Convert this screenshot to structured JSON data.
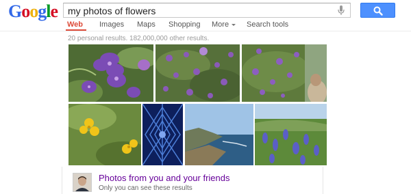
{
  "logo": {
    "text": "Google"
  },
  "search": {
    "query": "my photos of flowers",
    "button_icon": "search-icon"
  },
  "nav": {
    "tabs": [
      {
        "label": "Web",
        "active": true
      },
      {
        "label": "Images"
      },
      {
        "label": "Maps"
      },
      {
        "label": "Shopping"
      },
      {
        "label": "More"
      },
      {
        "label": "Search tools"
      }
    ]
  },
  "results": {
    "stats": "20 personal results. 182,000,000 other results."
  },
  "photos": [
    {
      "subject": "purple flowers close-up"
    },
    {
      "subject": "purple flower bush"
    },
    {
      "subject": "purple flower bush with person"
    },
    {
      "subject": "yellow flowers in grass"
    },
    {
      "subject": "blue geometric pattern"
    },
    {
      "subject": "coastal cliffs and ocean"
    },
    {
      "subject": "purple lupine field"
    }
  ],
  "friends": {
    "title": "Photos from you and your friends",
    "subtitle": "Only you can see these results"
  },
  "colors": {
    "accent": "#dd4b39",
    "button": "#4d90fe",
    "link": "#660099"
  }
}
